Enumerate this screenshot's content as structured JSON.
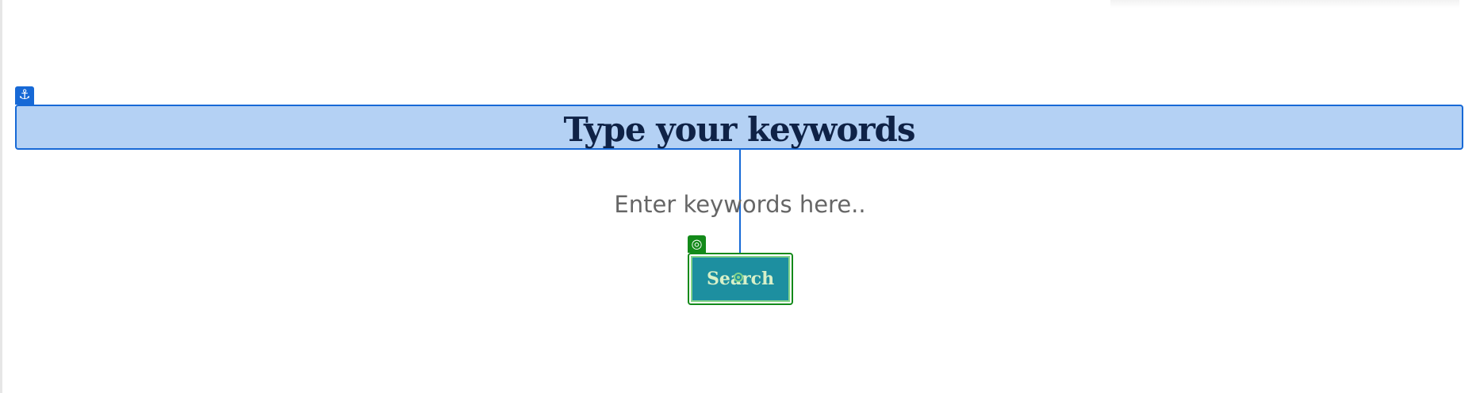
{
  "overlay": {
    "anchor_icon": "⚓",
    "target_icon": "◎"
  },
  "heading": {
    "text": "Type your keywords"
  },
  "search": {
    "placeholder": "Enter keywords here..",
    "button_label": "Search"
  },
  "colors": {
    "selection_blue": "#1769d6",
    "selection_fill": "#b4d1f4",
    "heading_text": "#0f2246",
    "button_bg": "#1d8fa0",
    "button_outline": "#138a1a",
    "button_text": "#d8f0c8"
  }
}
